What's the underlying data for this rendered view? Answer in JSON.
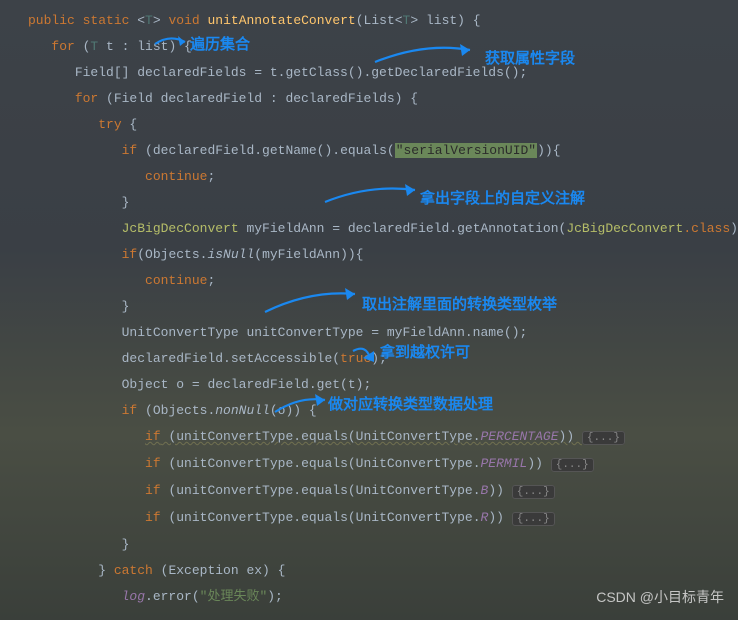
{
  "code": {
    "l1_public": "public",
    "l1_static": "static",
    "l1_t": "T",
    "l1_void": "void",
    "l1_fn": "unitAnnotateConvert",
    "l1_param": "(List<",
    "l1_t2": "T",
    "l1_paramend": "> list) {",
    "l2_for": "for",
    "l2_cond": " (",
    "l2_t": "T",
    "l2_rest": " t : list) {",
    "l3_a": "Field[] declaredFields = t.getClass().getDeclaredFields();",
    "l4_for": "for",
    "l4_rest": " (Field declaredField : declaredFields) {",
    "l5_try": "try",
    "l5_brace": " {",
    "l6_if": "if",
    "l6_a": " (declaredField.getName().equals(",
    "l6_str": "\"serialVersionUID\"",
    "l6_b": ")){",
    "l7_continue": "continue",
    "l7_semi": ";",
    "l8_brace": "}",
    "l9_type": "JcBigDecConvert",
    "l9_mid": " myFieldAnn = declaredField.getAnnotation(",
    "l9_type2": "JcBigDecConvert",
    "l9_class": ".class",
    "l9_end": ");",
    "l10_if": "if",
    "l10_a": "(Objects.",
    "l10_isnull": "isNull",
    "l10_b": "(myFieldAnn)){",
    "l11_continue": "continue",
    "l11_semi": ";",
    "l12_brace": "}",
    "l13_a": "UnitConvertType unitConvertType = myFieldAnn.name();",
    "l14_a": "declaredField.setAccessible(",
    "l14_true": "true",
    "l14_b": ");",
    "l15_a": "Object o = declaredField.get(t);",
    "l16_if": "if",
    "l16_a": " (Objects.",
    "l16_nonnull": "nonNull",
    "l16_b": "(o)) {",
    "l17_if": "if",
    "l17_a": " (unitConvertType.equals(UnitConvertType.",
    "l17_const": "PERCENTAGE",
    "l17_b": ")) ",
    "l18_if": "if",
    "l18_a": " (unitConvertType.equals(UnitConvertType.",
    "l18_const": "PERMIL",
    "l18_b": ")) ",
    "l19_if": "if",
    "l19_a": " (unitConvertType.equals(UnitConvertType.",
    "l19_const": "B",
    "l19_b": ")) ",
    "l20_if": "if",
    "l20_a": " (unitConvertType.equals(UnitConvertType.",
    "l20_const": "R",
    "l20_b": ")) ",
    "fold": "{...}",
    "l21_brace": "}",
    "l22_brace": "}",
    "l22_catch": " catch ",
    "l22_rest": "(Exception ex) {",
    "l23_log": "log",
    "l23_a": ".error(",
    "l23_str": "\"处理失败\"",
    "l23_b": ");"
  },
  "annotations": {
    "a1": "遍历集合",
    "a2": "获取属性字段",
    "a3": "拿出字段上的自定义注解",
    "a4": "取出注解里面的转换类型枚举",
    "a5": "拿到越权许可",
    "a6": "做对应转换类型数据处理"
  },
  "watermark": "CSDN @小目标青年"
}
